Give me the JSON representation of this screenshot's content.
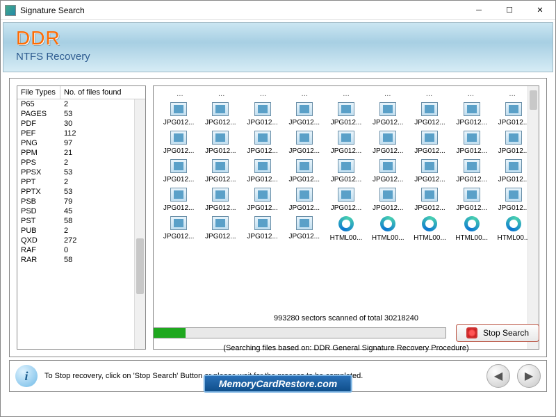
{
  "window": {
    "title": "Signature Search"
  },
  "banner": {
    "logo": "DDR",
    "subtitle": "NTFS Recovery"
  },
  "file_types": {
    "header": {
      "col1": "File Types",
      "col2": "No. of files found"
    },
    "rows": [
      {
        "type": "P65",
        "count": "2"
      },
      {
        "type": "PAGES",
        "count": "53"
      },
      {
        "type": "PDF",
        "count": "30"
      },
      {
        "type": "PEF",
        "count": "112"
      },
      {
        "type": "PNG",
        "count": "97"
      },
      {
        "type": "PPM",
        "count": "21"
      },
      {
        "type": "PPS",
        "count": "2"
      },
      {
        "type": "PPSX",
        "count": "53"
      },
      {
        "type": "PPT",
        "count": "2"
      },
      {
        "type": "PPTX",
        "count": "53"
      },
      {
        "type": "PSB",
        "count": "79"
      },
      {
        "type": "PSD",
        "count": "45"
      },
      {
        "type": "PST",
        "count": "58"
      },
      {
        "type": "PUB",
        "count": "2"
      },
      {
        "type": "QXD",
        "count": "272"
      },
      {
        "type": "RAF",
        "count": "0"
      },
      {
        "type": "RAR",
        "count": "58"
      }
    ]
  },
  "files": {
    "row_jpg": [
      "JPG012...",
      "JPG012...",
      "JPG012...",
      "JPG012...",
      "JPG012...",
      "JPG012...",
      "JPG012...",
      "JPG012...",
      "JPG012..."
    ],
    "row_mixed": [
      "JPG012...",
      "JPG012...",
      "JPG012...",
      "JPG012...",
      "HTML00...",
      "HTML00...",
      "HTML00...",
      "HTML00...",
      "HTML00..."
    ]
  },
  "progress": {
    "label": "993280 sectors scanned of total 30218240",
    "basis": "(Searching files based on:  DDR General Signature Recovery Procedure)",
    "stop_label": "Stop Search"
  },
  "footer": {
    "hint": "To Stop recovery, click on 'Stop Search' Button or please wait for the process to be completed.",
    "site": "MemoryCardRestore.com"
  }
}
